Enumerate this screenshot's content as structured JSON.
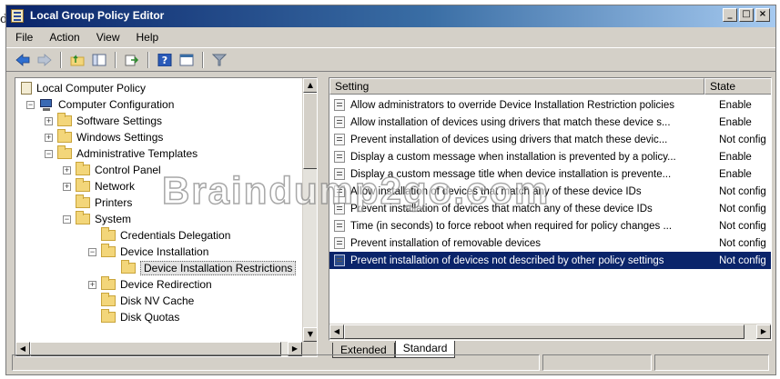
{
  "stray_text": "d",
  "window": {
    "title": "Local Group Policy Editor",
    "controls": {
      "minimize": "_",
      "maximize": "□",
      "close": "×"
    }
  },
  "menu": [
    "File",
    "Action",
    "View",
    "Help"
  ],
  "toolbar": {
    "icons": [
      "back-arrow-icon",
      "forward-arrow-icon",
      "up-folder-icon",
      "show-hide-tree-icon",
      "export-list-icon",
      "help-icon",
      "properties-icon",
      "filter-icon"
    ]
  },
  "tree": {
    "items": [
      {
        "label": "Local Computer Policy",
        "icon": "doc",
        "expander": ""
      },
      {
        "label": "Computer Configuration",
        "icon": "computer",
        "expander": "−"
      },
      {
        "label": "Software Settings",
        "icon": "folder",
        "expander": "+"
      },
      {
        "label": "Windows Settings",
        "icon": "folder",
        "expander": "+"
      },
      {
        "label": "Administrative Templates",
        "icon": "folder",
        "expander": "−"
      },
      {
        "label": "Control Panel",
        "icon": "folder",
        "expander": "+"
      },
      {
        "label": "Network",
        "icon": "folder",
        "expander": "+"
      },
      {
        "label": "Printers",
        "icon": "folder",
        "expander": ""
      },
      {
        "label": "System",
        "icon": "folder",
        "expander": "−"
      },
      {
        "label": "Credentials Delegation",
        "icon": "folder",
        "expander": ""
      },
      {
        "label": "Device Installation",
        "icon": "folder",
        "expander": "−"
      },
      {
        "label": "Device Installation Restrictions",
        "icon": "folder",
        "expander": "",
        "selected": true
      },
      {
        "label": "Device Redirection",
        "icon": "folder",
        "expander": "+"
      },
      {
        "label": "Disk NV Cache",
        "icon": "folder",
        "expander": ""
      },
      {
        "label": "Disk Quotas",
        "icon": "folder",
        "expander": ""
      }
    ]
  },
  "list": {
    "columns": {
      "setting": "Setting",
      "state": "State"
    },
    "rows": [
      {
        "setting": "Allow administrators to override Device Installation Restriction policies",
        "state": "Enable"
      },
      {
        "setting": "Allow installation of devices using drivers that match these device s...",
        "state": "Enable"
      },
      {
        "setting": "Prevent installation of devices using drivers that match these devic...",
        "state": "Not config"
      },
      {
        "setting": "Display a custom message when installation is prevented by a policy...",
        "state": "Enable"
      },
      {
        "setting": "Display a custom message title when device installation is prevente...",
        "state": "Enable"
      },
      {
        "setting": "Allow installation of devices that match any of these device IDs",
        "state": "Not config"
      },
      {
        "setting": "Prevent installation of devices that match any of these device IDs",
        "state": "Not config"
      },
      {
        "setting": "Time (in seconds) to force reboot when required for policy changes ...",
        "state": "Not config"
      },
      {
        "setting": "Prevent installation of removable devices",
        "state": "Not config"
      },
      {
        "setting": "Prevent installation of devices not described by other policy settings",
        "state": "Not config",
        "selected": true
      }
    ]
  },
  "tabs": [
    "Extended",
    "Standard"
  ],
  "active_tab": "Standard",
  "watermark": "Braindump2go.com",
  "colors": {
    "title_start": "#0a246a",
    "title_end": "#a6caf0",
    "selection": "#0a246a",
    "chrome": "#d4d0c8"
  }
}
